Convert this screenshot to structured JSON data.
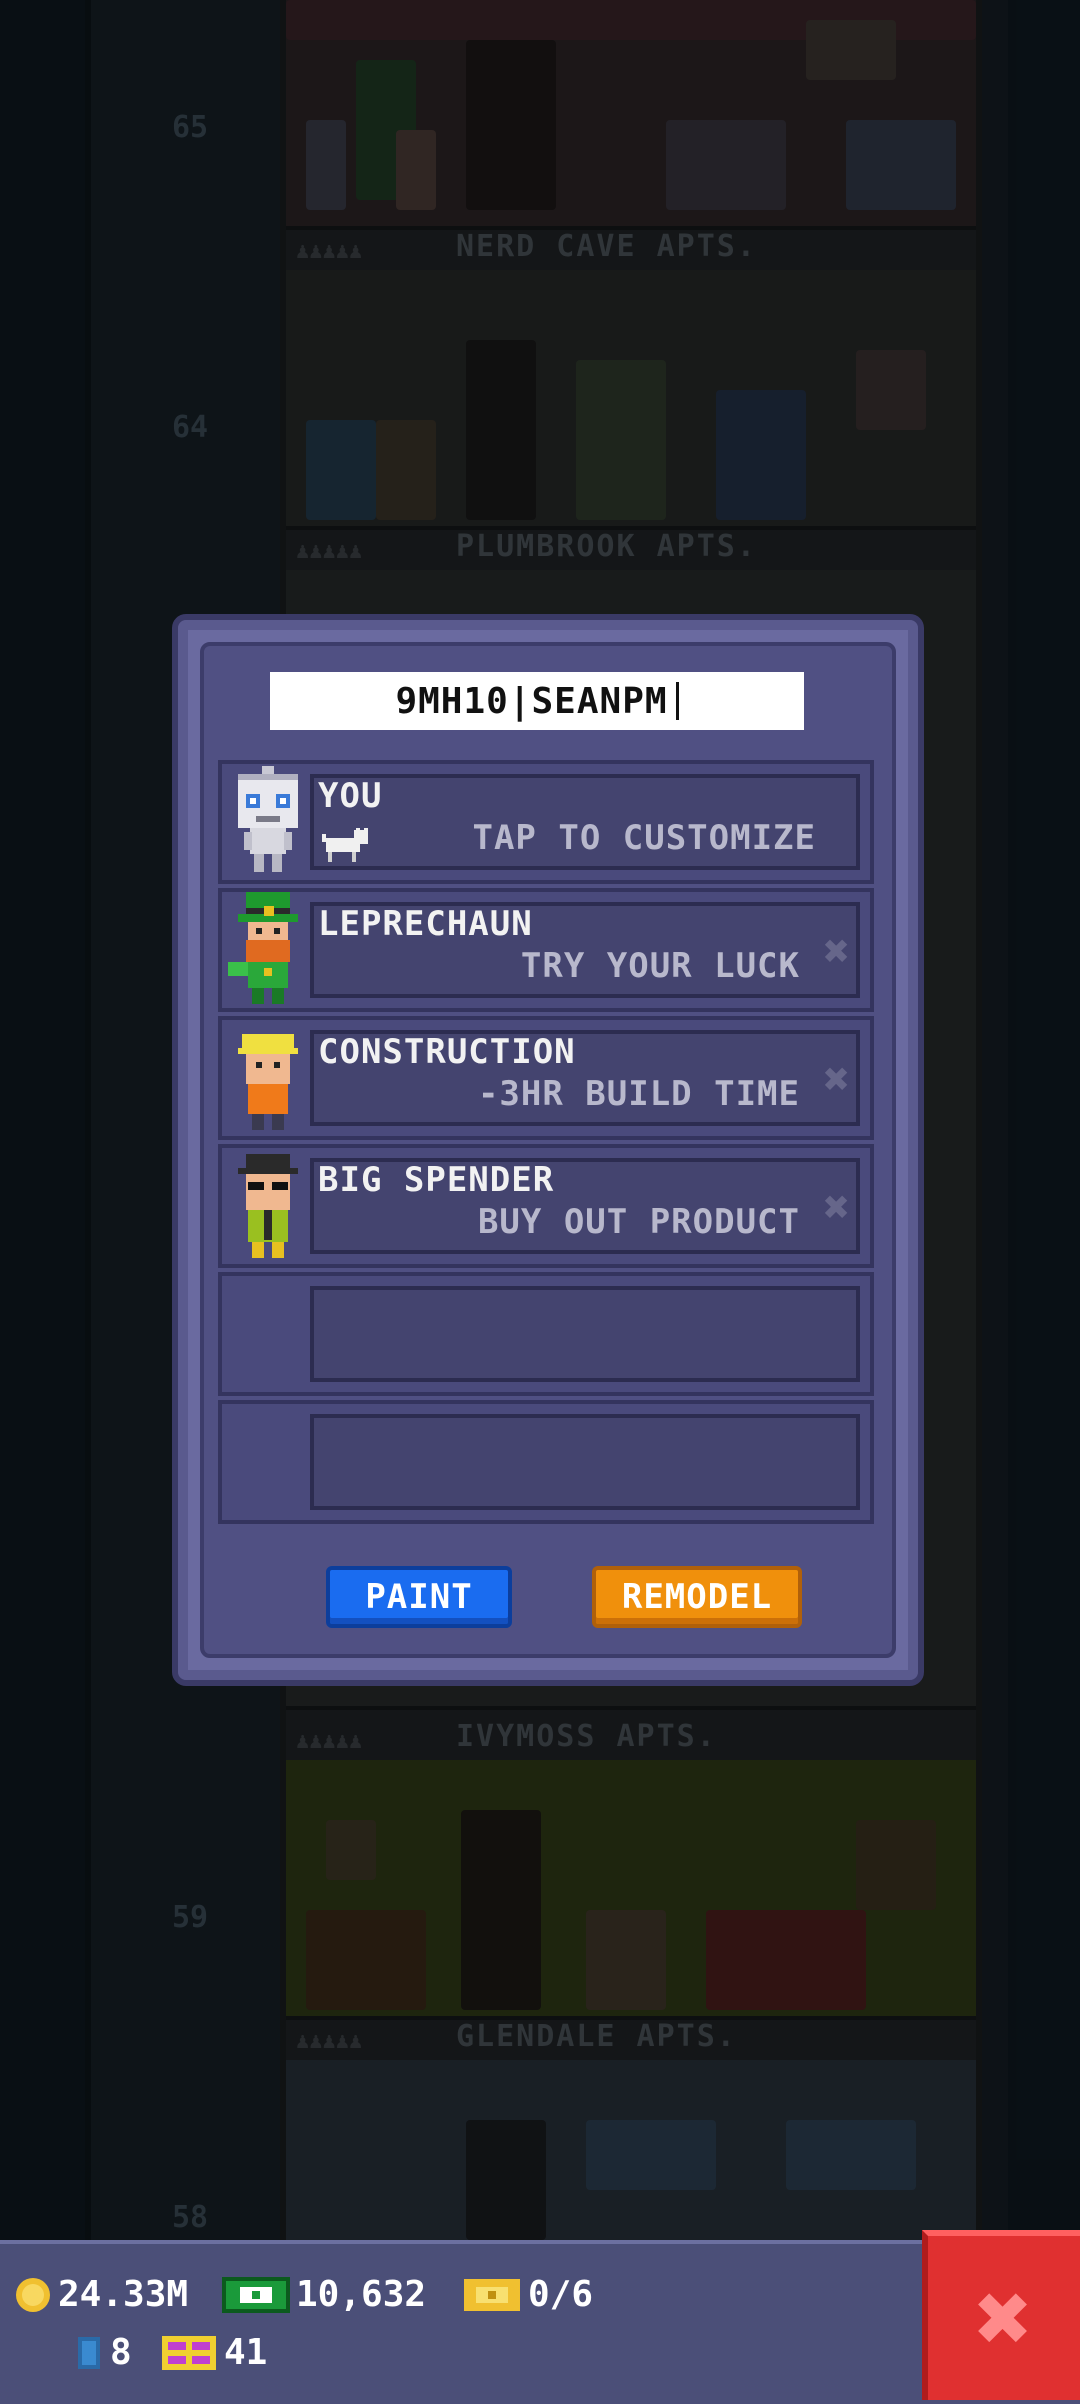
{
  "tower": {
    "floors": [
      {
        "number": "65",
        "name": "NERD CAVE APTS."
      },
      {
        "number": "64",
        "name": "PLUMBROOK APTS."
      },
      {
        "number": "",
        "name": "IVYMOSS APTS."
      },
      {
        "number": "59",
        "name": "GLENDALE APTS."
      },
      {
        "number": "58",
        "name": ""
      }
    ]
  },
  "dialog": {
    "name_value": "9MH10|SEANPM",
    "rows": [
      {
        "title": "YOU",
        "subtitle": "TAP TO CUSTOMIZE",
        "removable": false
      },
      {
        "title": "LEPRECHAUN",
        "subtitle": "TRY YOUR LUCK",
        "removable": true
      },
      {
        "title": "CONSTRUCTION",
        "subtitle": "-3HR BUILD TIME",
        "removable": true
      },
      {
        "title": "BIG SPENDER",
        "subtitle": "BUY OUT PRODUCT",
        "removable": true
      },
      {
        "title": "",
        "subtitle": "",
        "removable": false
      },
      {
        "title": "",
        "subtitle": "",
        "removable": false
      }
    ],
    "remove_glyph": "✖",
    "paint_label": "PAINT",
    "remodel_label": "REMODEL"
  },
  "status": {
    "coins": "24.33M",
    "bux": "10,632",
    "tickets": "0/6",
    "elevators": "8",
    "gift": "41"
  },
  "close_glyph": "✖",
  "colors": {
    "paint_button": "#1a6cf0",
    "remodel_button": "#f0900c",
    "close_button": "#e03030",
    "dialog_frame": "#6a6aa0"
  }
}
